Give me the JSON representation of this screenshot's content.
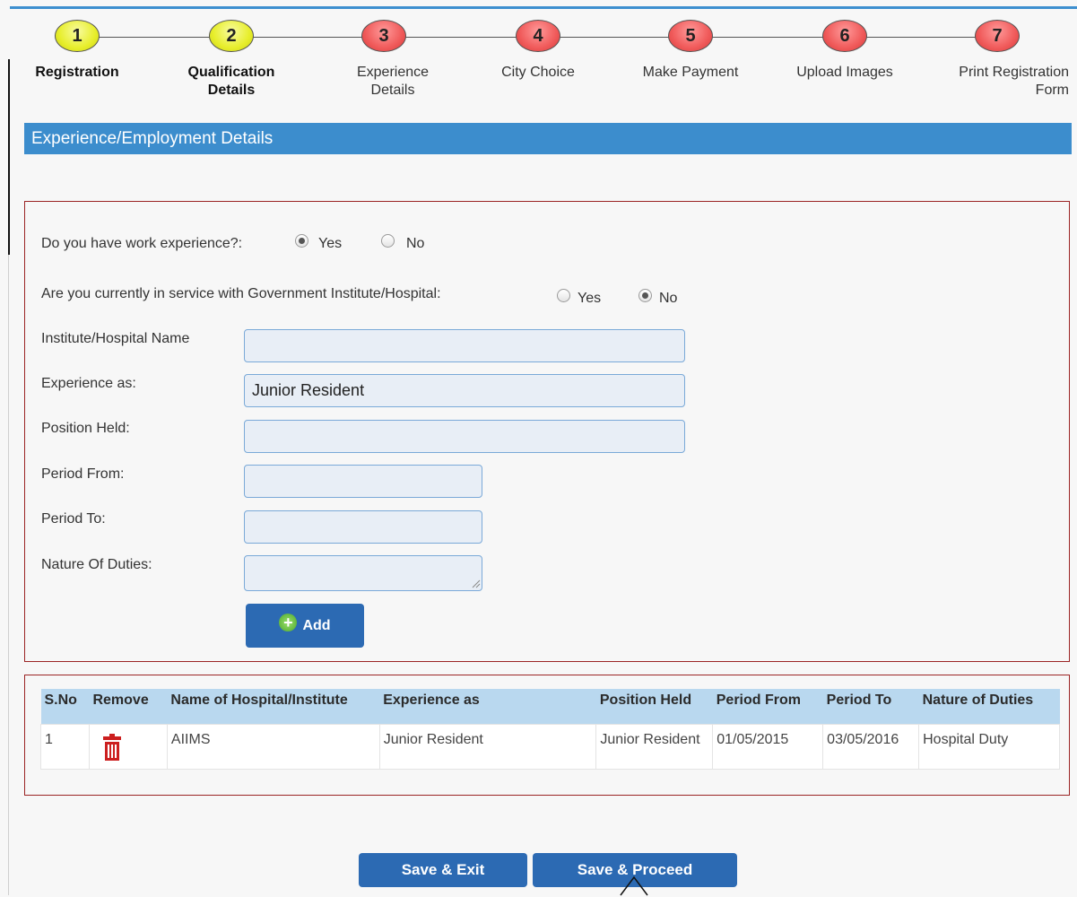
{
  "stepper": {
    "steps": [
      {
        "number": "1",
        "label": "Registration",
        "state": "done"
      },
      {
        "number": "2",
        "label": "Qualification Details",
        "state": "done"
      },
      {
        "number": "3",
        "label": "Experience Details",
        "state": "todo"
      },
      {
        "number": "4",
        "label": "City Choice",
        "state": "todo"
      },
      {
        "number": "5",
        "label": "Make Payment",
        "state": "todo"
      },
      {
        "number": "6",
        "label": "Upload Images",
        "state": "todo"
      },
      {
        "number": "7",
        "label": "Print Registration Form",
        "state": "todo"
      }
    ]
  },
  "section": {
    "title": "Experience/Employment Details"
  },
  "form": {
    "work_experience": {
      "question": "Do you have work experience?:",
      "yes": "Yes",
      "no": "No",
      "selected": "Yes"
    },
    "gov_service": {
      "question": "Are you currently in service with Government Institute/Hospital:",
      "yes": "Yes",
      "no": "No",
      "selected": "No"
    },
    "fields": {
      "institute": {
        "label": "Institute/Hospital Name",
        "value": ""
      },
      "experience_as": {
        "label": "Experience as:",
        "value": "Junior Resident"
      },
      "position": {
        "label": "Position Held:",
        "value": ""
      },
      "period_from": {
        "label": "Period From:",
        "value": ""
      },
      "period_to": {
        "label": "Period To:",
        "value": ""
      },
      "duties": {
        "label": "Nature Of Duties:",
        "value": ""
      }
    },
    "add_label": "Add"
  },
  "table": {
    "headers": [
      "S.No",
      "Remove",
      "Name of Hospital/Institute",
      "Experience as",
      "Position Held",
      "Period From",
      "Period To",
      "Nature of Duties"
    ],
    "rows": [
      [
        "1",
        "",
        "AIIMS",
        "Junior Resident",
        "Junior Resident",
        "01/05/2015",
        "03/05/2016",
        "Hospital Duty"
      ]
    ]
  },
  "actions": {
    "save_exit": "Save & Exit",
    "save_proceed": "Save & Proceed"
  },
  "colors": {
    "accent": "#3c8dcd",
    "button": "#2c6ab3",
    "border": "#9b2424",
    "step_done": "#e7ee2b",
    "step_todo": "#f05a5a",
    "remove_icon": "#cc1f1f"
  },
  "icons": {
    "add": "plus-circle-icon",
    "remove": "trash-icon"
  }
}
